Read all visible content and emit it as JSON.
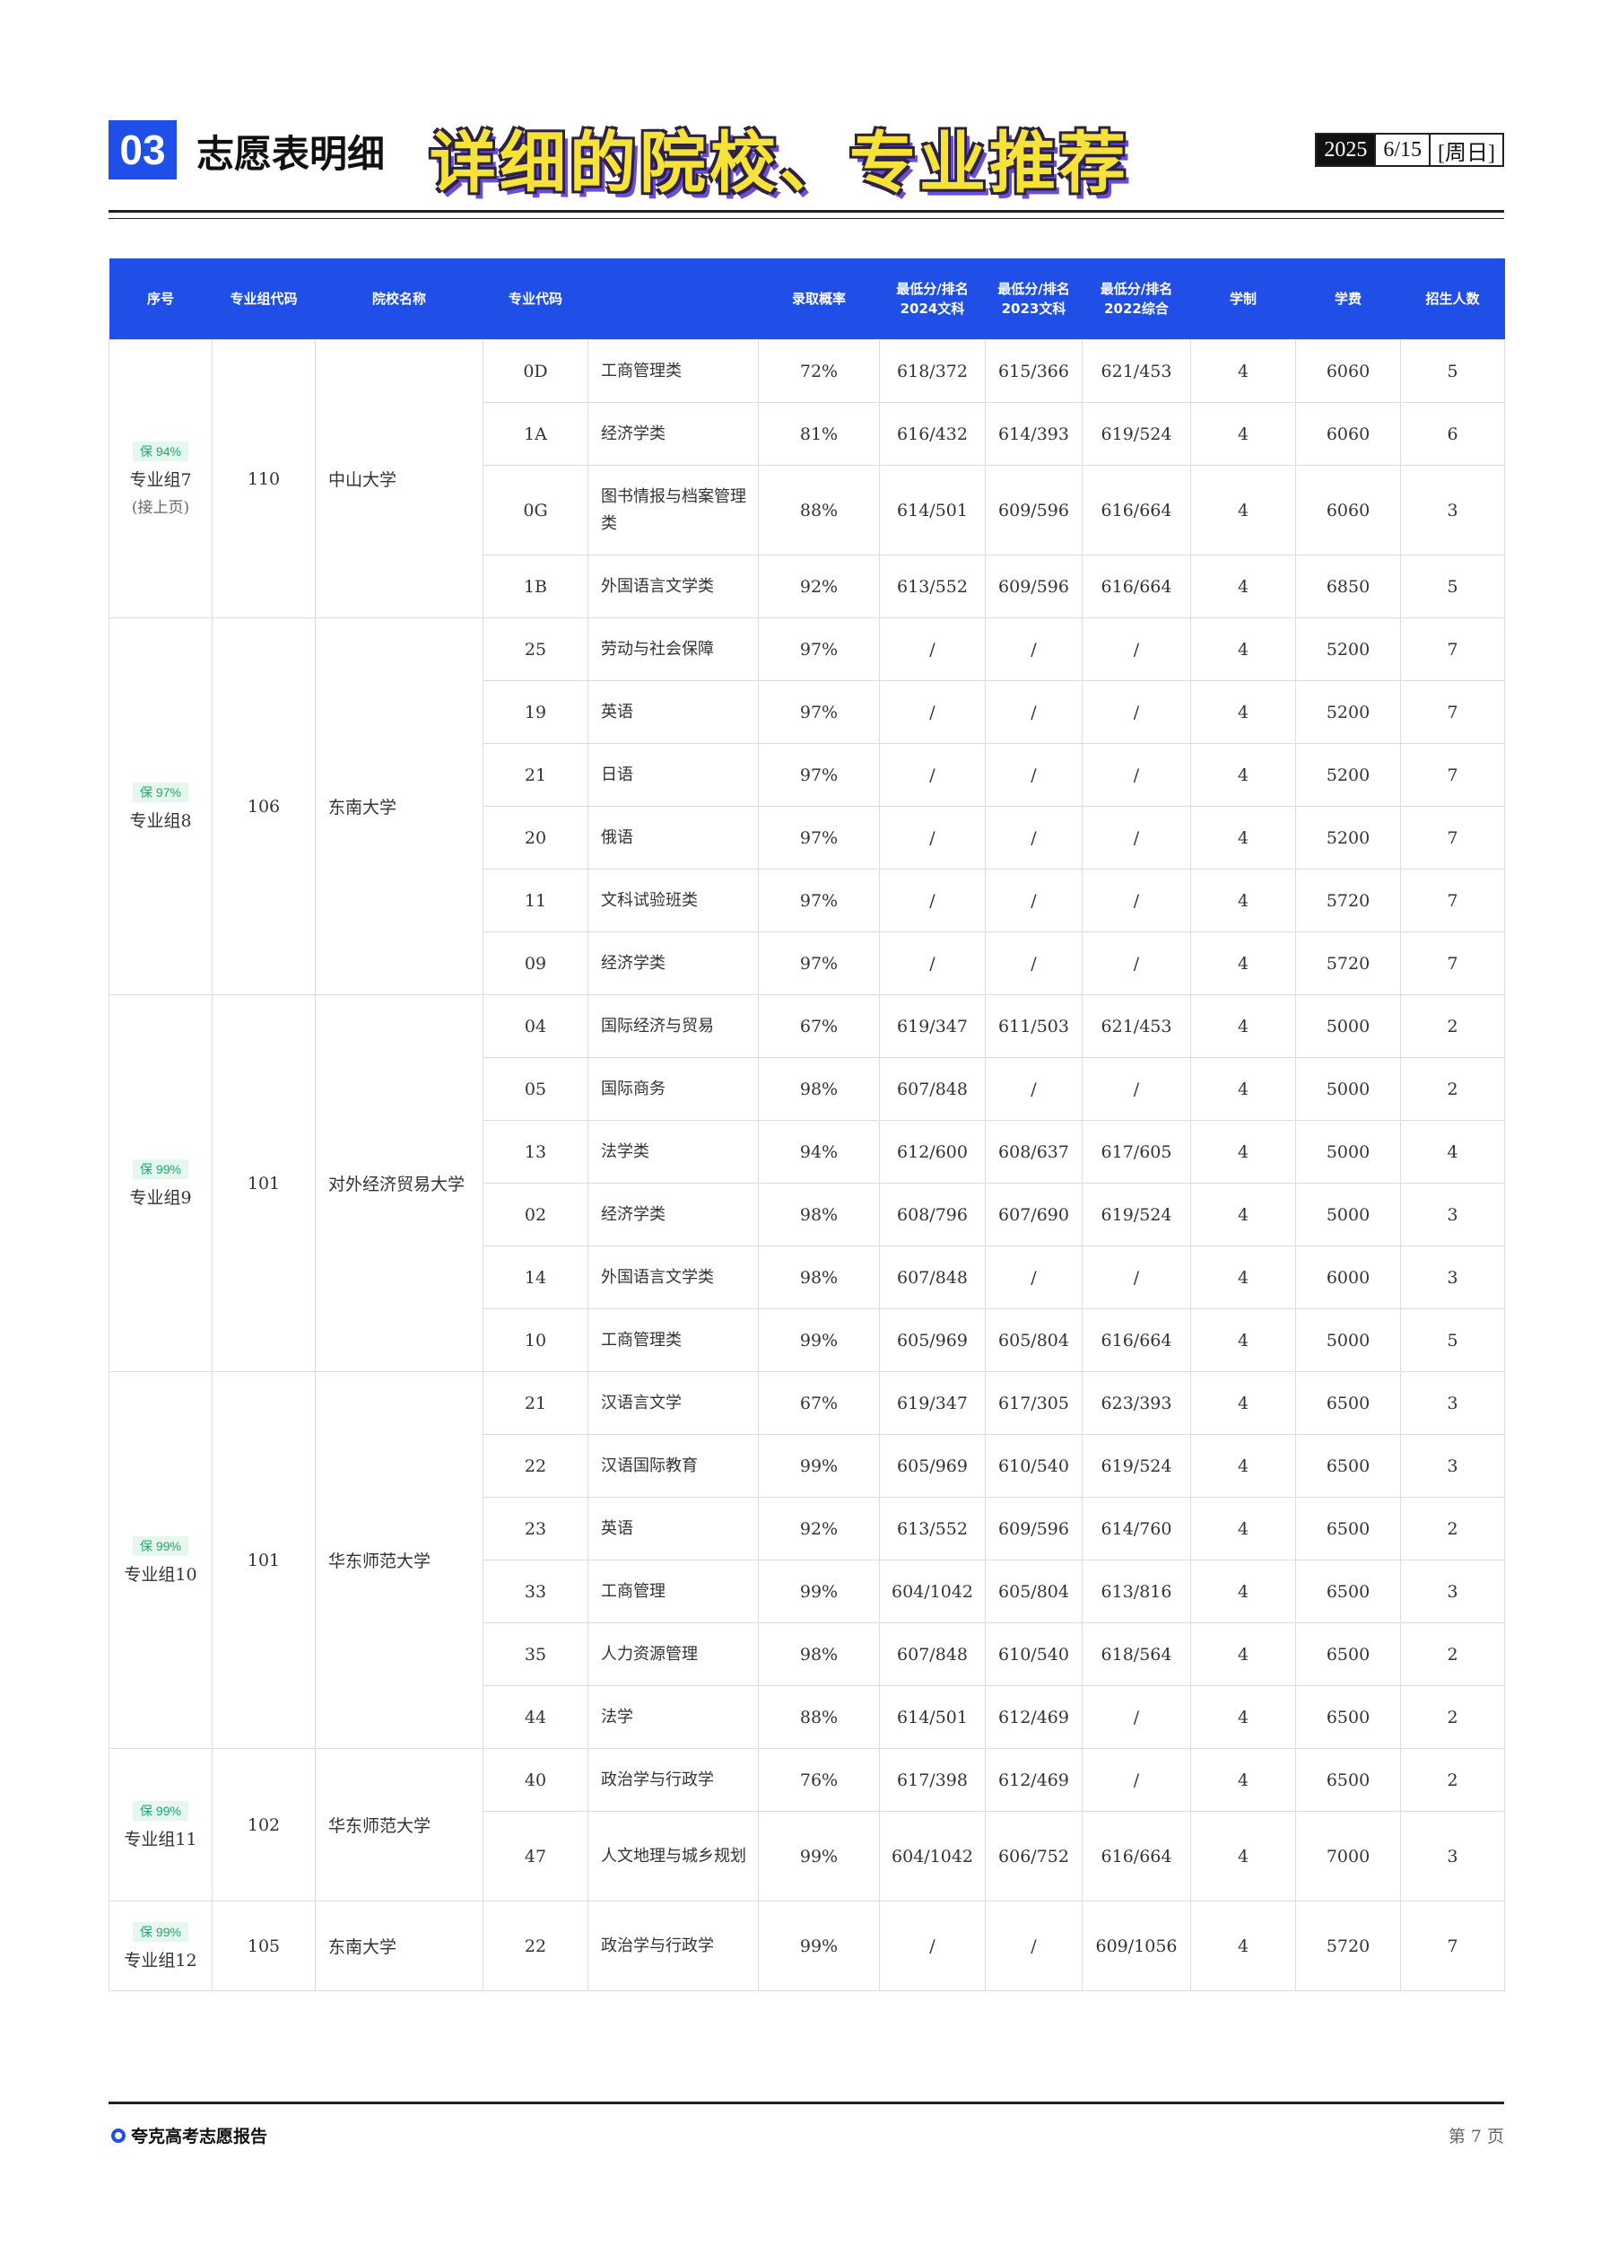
{
  "header": {
    "section_number": "03",
    "section_title": "志愿表明细",
    "banner": "详细的院校、专业推荐",
    "date_year": "2025",
    "date_md": "6/15",
    "date_weekday": "[周日]"
  },
  "table": {
    "columns": [
      {
        "line1": "序号",
        "line2": ""
      },
      {
        "line1": "专业组代码",
        "line2": ""
      },
      {
        "line1": "院校名称",
        "line2": ""
      },
      {
        "line1": "专业代码",
        "line2": ""
      },
      {
        "line1": "",
        "line2": ""
      },
      {
        "line1": "录取概率",
        "line2": ""
      },
      {
        "line1": "最低分/排名",
        "line2": "2024文科"
      },
      {
        "line1": "最低分/排名",
        "line2": "2023文科"
      },
      {
        "line1": "最低分/排名",
        "line2": "2022综合"
      },
      {
        "line1": "学制",
        "line2": ""
      },
      {
        "line1": "学费",
        "line2": ""
      },
      {
        "line1": "招生人数",
        "line2": ""
      }
    ],
    "groups": [
      {
        "badge": "保 94%",
        "group": "专业组7",
        "note": "(接上页)",
        "group_code": "110",
        "school": "中山大学",
        "rows": [
          {
            "code": "0D",
            "major": "工商管理类",
            "prob": "72%",
            "s2024": "618/372",
            "s2023": "615/366",
            "s2022": "621/453",
            "years": "4",
            "fee": "6060",
            "count": "5"
          },
          {
            "code": "1A",
            "major": "经济学类",
            "prob": "81%",
            "s2024": "616/432",
            "s2023": "614/393",
            "s2022": "619/524",
            "years": "4",
            "fee": "6060",
            "count": "6"
          },
          {
            "code": "0G",
            "major": "图书情报与档案管理类",
            "prob": "88%",
            "s2024": "614/501",
            "s2023": "609/596",
            "s2022": "616/664",
            "years": "4",
            "fee": "6060",
            "count": "3",
            "tall": true
          },
          {
            "code": "1B",
            "major": "外国语言文学类",
            "prob": "92%",
            "s2024": "613/552",
            "s2023": "609/596",
            "s2022": "616/664",
            "years": "4",
            "fee": "6850",
            "count": "5"
          }
        ]
      },
      {
        "badge": "保 97%",
        "group": "专业组8",
        "note": "",
        "group_code": "106",
        "school": "东南大学",
        "rows": [
          {
            "code": "25",
            "major": "劳动与社会保障",
            "prob": "97%",
            "s2024": "/",
            "s2023": "/",
            "s2022": "/",
            "years": "4",
            "fee": "5200",
            "count": "7"
          },
          {
            "code": "19",
            "major": "英语",
            "prob": "97%",
            "s2024": "/",
            "s2023": "/",
            "s2022": "/",
            "years": "4",
            "fee": "5200",
            "count": "7"
          },
          {
            "code": "21",
            "major": "日语",
            "prob": "97%",
            "s2024": "/",
            "s2023": "/",
            "s2022": "/",
            "years": "4",
            "fee": "5200",
            "count": "7"
          },
          {
            "code": "20",
            "major": "俄语",
            "prob": "97%",
            "s2024": "/",
            "s2023": "/",
            "s2022": "/",
            "years": "4",
            "fee": "5200",
            "count": "7"
          },
          {
            "code": "11",
            "major": "文科试验班类",
            "prob": "97%",
            "s2024": "/",
            "s2023": "/",
            "s2022": "/",
            "years": "4",
            "fee": "5720",
            "count": "7"
          },
          {
            "code": "09",
            "major": "经济学类",
            "prob": "97%",
            "s2024": "/",
            "s2023": "/",
            "s2022": "/",
            "years": "4",
            "fee": "5720",
            "count": "7"
          }
        ]
      },
      {
        "badge": "保 99%",
        "group": "专业组9",
        "note": "",
        "group_code": "101",
        "school": "对外经济贸易大学",
        "rows": [
          {
            "code": "04",
            "major": "国际经济与贸易",
            "prob": "67%",
            "s2024": "619/347",
            "s2023": "611/503",
            "s2022": "621/453",
            "years": "4",
            "fee": "5000",
            "count": "2"
          },
          {
            "code": "05",
            "major": "国际商务",
            "prob": "98%",
            "s2024": "607/848",
            "s2023": "/",
            "s2022": "/",
            "years": "4",
            "fee": "5000",
            "count": "2"
          },
          {
            "code": "13",
            "major": "法学类",
            "prob": "94%",
            "s2024": "612/600",
            "s2023": "608/637",
            "s2022": "617/605",
            "years": "4",
            "fee": "5000",
            "count": "4"
          },
          {
            "code": "02",
            "major": "经济学类",
            "prob": "98%",
            "s2024": "608/796",
            "s2023": "607/690",
            "s2022": "619/524",
            "years": "4",
            "fee": "5000",
            "count": "3"
          },
          {
            "code": "14",
            "major": "外国语言文学类",
            "prob": "98%",
            "s2024": "607/848",
            "s2023": "/",
            "s2022": "/",
            "years": "4",
            "fee": "6000",
            "count": "3"
          },
          {
            "code": "10",
            "major": "工商管理类",
            "prob": "99%",
            "s2024": "605/969",
            "s2023": "605/804",
            "s2022": "616/664",
            "years": "4",
            "fee": "5000",
            "count": "5"
          }
        ]
      },
      {
        "badge": "保 99%",
        "group": "专业组10",
        "note": "",
        "group_code": "101",
        "school": "华东师范大学",
        "rows": [
          {
            "code": "21",
            "major": "汉语言文学",
            "prob": "67%",
            "s2024": "619/347",
            "s2023": "617/305",
            "s2022": "623/393",
            "years": "4",
            "fee": "6500",
            "count": "3"
          },
          {
            "code": "22",
            "major": "汉语国际教育",
            "prob": "99%",
            "s2024": "605/969",
            "s2023": "610/540",
            "s2022": "619/524",
            "years": "4",
            "fee": "6500",
            "count": "3"
          },
          {
            "code": "23",
            "major": "英语",
            "prob": "92%",
            "s2024": "613/552",
            "s2023": "609/596",
            "s2022": "614/760",
            "years": "4",
            "fee": "6500",
            "count": "2"
          },
          {
            "code": "33",
            "major": "工商管理",
            "prob": "99%",
            "s2024": "604/1042",
            "s2023": "605/804",
            "s2022": "613/816",
            "years": "4",
            "fee": "6500",
            "count": "3"
          },
          {
            "code": "35",
            "major": "人力资源管理",
            "prob": "98%",
            "s2024": "607/848",
            "s2023": "610/540",
            "s2022": "618/564",
            "years": "4",
            "fee": "6500",
            "count": "2"
          },
          {
            "code": "44",
            "major": "法学",
            "prob": "88%",
            "s2024": "614/501",
            "s2023": "612/469",
            "s2022": "/",
            "years": "4",
            "fee": "6500",
            "count": "2"
          }
        ]
      },
      {
        "badge": "保 99%",
        "group": "专业组11",
        "note": "",
        "group_code": "102",
        "school": "华东师范大学",
        "rows": [
          {
            "code": "40",
            "major": "政治学与行政学",
            "prob": "76%",
            "s2024": "617/398",
            "s2023": "612/469",
            "s2022": "/",
            "years": "4",
            "fee": "6500",
            "count": "2"
          },
          {
            "code": "47",
            "major": "人文地理与城乡规划",
            "prob": "99%",
            "s2024": "604/1042",
            "s2023": "606/752",
            "s2022": "616/664",
            "years": "4",
            "fee": "7000",
            "count": "3",
            "tall": true
          }
        ]
      },
      {
        "badge": "保 99%",
        "group": "专业组12",
        "note": "",
        "group_code": "105",
        "school": "东南大学",
        "rows": [
          {
            "code": "22",
            "major": "政治学与行政学",
            "prob": "99%",
            "s2024": "/",
            "s2023": "/",
            "s2022": "609/1056",
            "years": "4",
            "fee": "5720",
            "count": "7",
            "tall": true
          }
        ]
      }
    ]
  },
  "footer": {
    "brand": "夸克高考志愿报告",
    "page": "第 7 页"
  }
}
